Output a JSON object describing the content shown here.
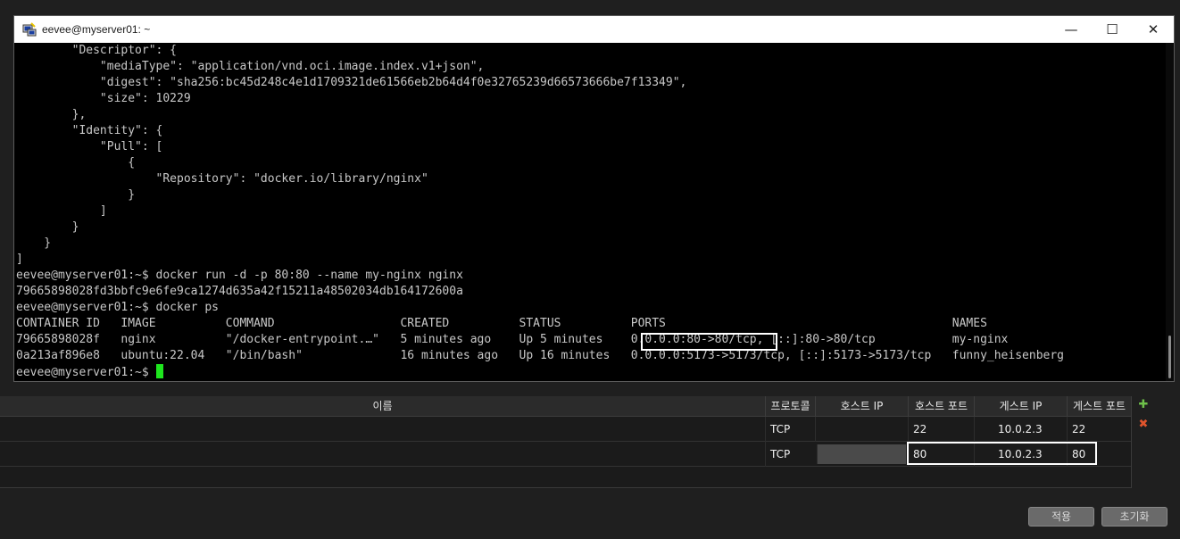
{
  "terminal": {
    "title": "eevee@myserver01: ~",
    "controls": {
      "minimize": "—",
      "maximize": "☐",
      "close": "✕"
    },
    "lines": [
      "        \"Descriptor\": {",
      "            \"mediaType\": \"application/vnd.oci.image.index.v1+json\",",
      "            \"digest\": \"sha256:bc45d248c4e1d1709321de61566eb2b64d4f0e32765239d66573666be7f13349\",",
      "            \"size\": 10229",
      "        },",
      "        \"Identity\": {",
      "            \"Pull\": [",
      "                {",
      "                    \"Repository\": \"docker.io/library/nginx\"",
      "                }",
      "            ]",
      "        }",
      "    }",
      "]",
      "eevee@myserver01:~$ docker run -d -p 80:80 --name my-nginx nginx",
      "79665898028fd3bbfc9e6fe9ca1274d635a42f15211a48502034db164172600a",
      "eevee@myserver01:~$ docker ps",
      "CONTAINER ID   IMAGE          COMMAND                  CREATED          STATUS          PORTS                                         NAMES",
      "79665898028f   nginx          \"/docker-entrypoint.…\"   5 minutes ago    Up 5 minutes    0.0.0.0:80->80/tcp, [::]:80->80/tcp           my-nginx",
      "0a213af896e8   ubuntu:22.04   \"/bin/bash\"              16 minutes ago   Up 16 minutes   0.0.0.0:5173->5173/tcp, [::]:5173->5173/tcp   funny_heisenberg"
    ],
    "prompt": "eevee@myserver01:~$ "
  },
  "port_forwarding": {
    "columns": [
      "이름",
      "프로토콜",
      "호스트 IP",
      "호스트 포트",
      "게스트 IP",
      "게스트 포트"
    ],
    "rows": [
      {
        "name": "",
        "protocol": "TCP",
        "host_ip": "",
        "host_port": "22",
        "guest_ip": "10.0.2.3",
        "guest_port": "22"
      },
      {
        "name": "",
        "protocol": "TCP",
        "host_ip": "",
        "host_port": "80",
        "guest_ip": "10.0.2.3",
        "guest_port": "80"
      }
    ],
    "add_icon": "add-rule-icon",
    "remove_icon": "remove-rule-icon"
  },
  "footer": {
    "apply": "적용",
    "reset": "초기화"
  },
  "colors": {
    "cursor": "#1ee61e",
    "terminal_bg": "#000000",
    "terminal_fg": "#c8c8c8"
  }
}
